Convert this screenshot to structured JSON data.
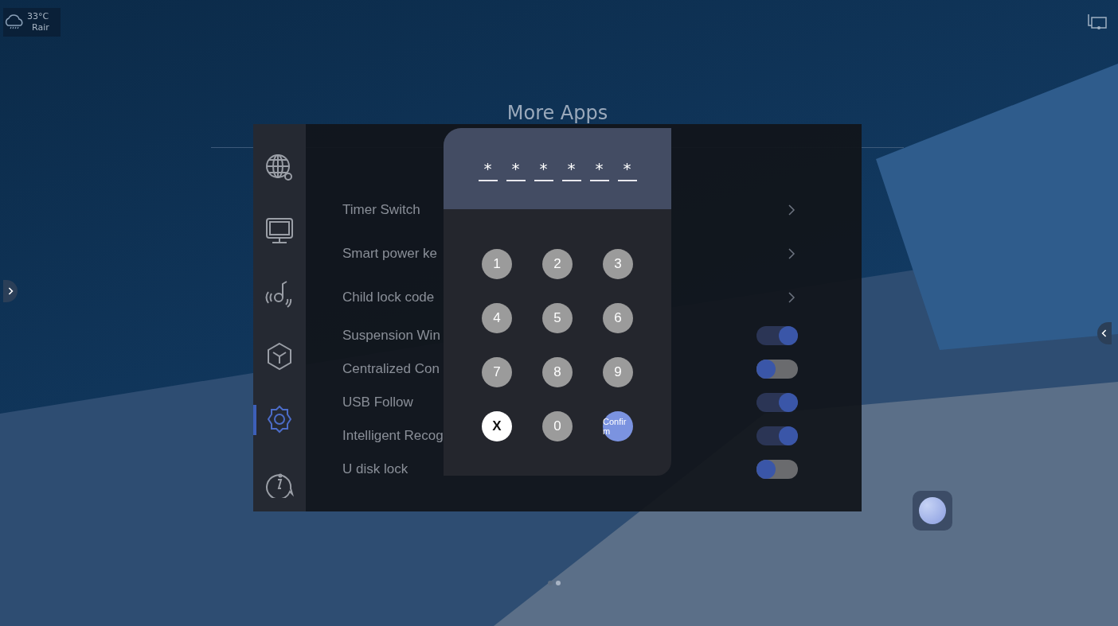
{
  "status": {
    "temperature": "33°C",
    "weather": "Rair"
  },
  "title": "More Apps",
  "sidebar": [
    {
      "kind": "network",
      "selected": false
    },
    {
      "kind": "display",
      "selected": false
    },
    {
      "kind": "sound",
      "selected": false
    },
    {
      "kind": "apps",
      "selected": false
    },
    {
      "kind": "settings",
      "selected": true
    },
    {
      "kind": "about",
      "selected": false
    }
  ],
  "rows": [
    {
      "label": "Timer Switch",
      "kind": "link"
    },
    {
      "label": "Smart power ke",
      "kind": "link"
    },
    {
      "label": "Child lock code",
      "kind": "link"
    },
    {
      "label": "Suspension Win",
      "kind": "toggle",
      "on": true
    },
    {
      "label": "Centralized Con",
      "kind": "toggle",
      "on": false
    },
    {
      "label": "USB Follow",
      "kind": "toggle",
      "on": true
    },
    {
      "label": "Intelligent Recog",
      "kind": "toggle",
      "on": true
    },
    {
      "label": "U disk lock",
      "kind": "toggle",
      "on": false
    }
  ],
  "keypad": {
    "entered": [
      "*",
      "*",
      "*",
      "*",
      "*",
      "*"
    ],
    "keys": [
      {
        "label": "1",
        "kind": "digit"
      },
      {
        "label": "2",
        "kind": "digit"
      },
      {
        "label": "3",
        "kind": "digit"
      },
      {
        "label": "4",
        "kind": "digit"
      },
      {
        "label": "5",
        "kind": "digit"
      },
      {
        "label": "6",
        "kind": "digit"
      },
      {
        "label": "7",
        "kind": "digit"
      },
      {
        "label": "8",
        "kind": "digit"
      },
      {
        "label": "9",
        "kind": "digit"
      },
      {
        "label": "X",
        "kind": "clear"
      },
      {
        "label": "0",
        "kind": "digit"
      },
      {
        "label": "Confirm",
        "kind": "confirm"
      }
    ]
  },
  "pages": [
    {
      "selected": false
    },
    {
      "selected": true
    }
  ]
}
